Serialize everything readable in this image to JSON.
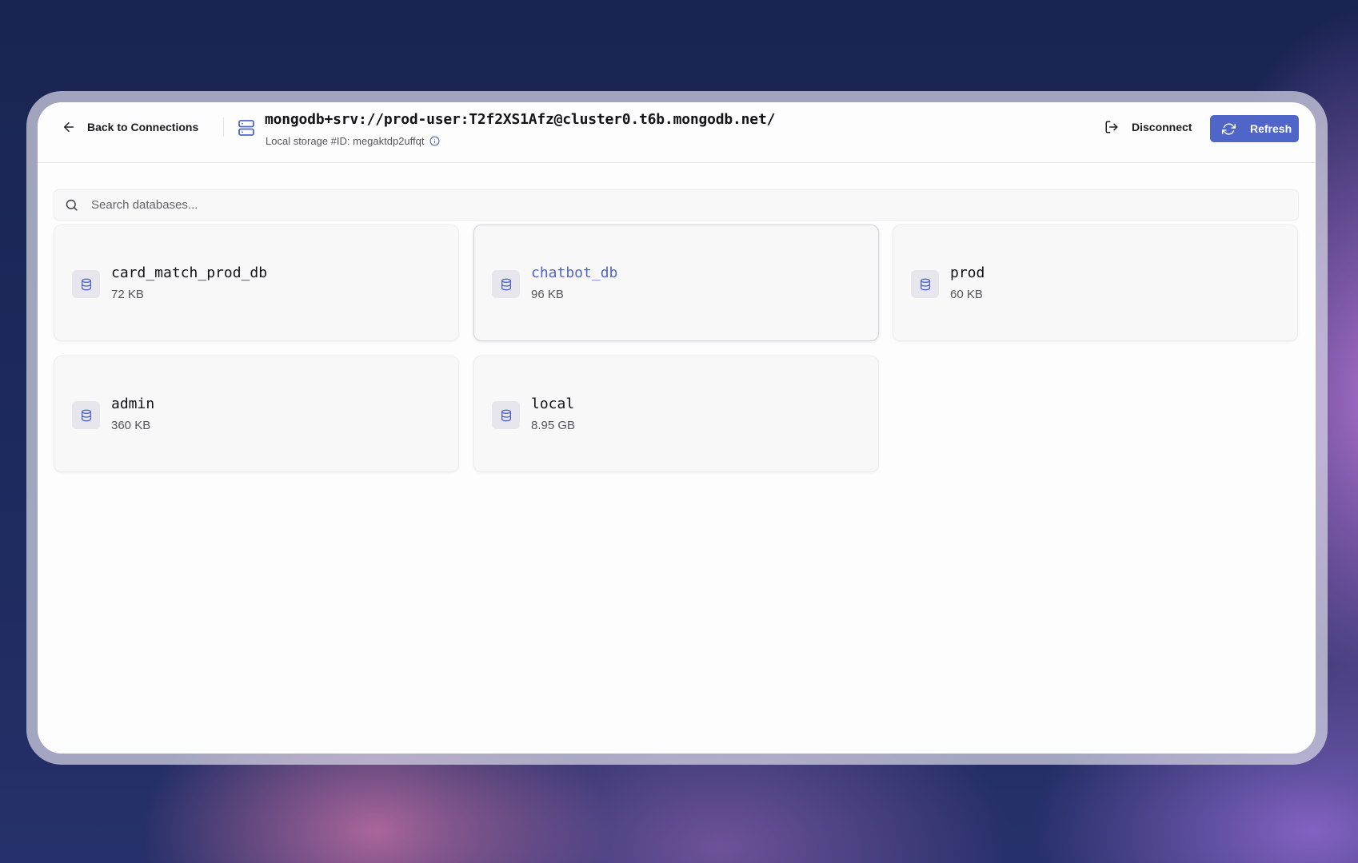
{
  "header": {
    "back_label": "Back to Connections",
    "connection_uri": "mongodb+srv://prod-user:T2f2XS1Afz@cluster0.t6b.mongodb.net/",
    "storage_info": "Local storage #ID: megaktdp2uffqt",
    "disconnect_label": "Disconnect",
    "refresh_label": "Refresh"
  },
  "search": {
    "placeholder": "Search databases...",
    "value": ""
  },
  "databases": [
    {
      "name": "card_match_prod_db",
      "size": "72 KB"
    },
    {
      "name": "chatbot_db",
      "size": "96 KB",
      "hovered": true
    },
    {
      "name": "prod",
      "size": "60 KB"
    },
    {
      "name": "admin",
      "size": "360 KB"
    },
    {
      "name": "local",
      "size": "8.95 GB"
    }
  ],
  "colors": {
    "accent": "#4f65c8",
    "text_primary": "#121218",
    "text_secondary": "#55555e",
    "card_background": "#f8f8f8"
  },
  "icons": {
    "back": "arrow-left-icon",
    "connection": "server-icon",
    "info": "info-icon",
    "disconnect": "log-out-icon",
    "refresh": "refresh-icon",
    "search": "search-icon",
    "database": "database-icon"
  }
}
